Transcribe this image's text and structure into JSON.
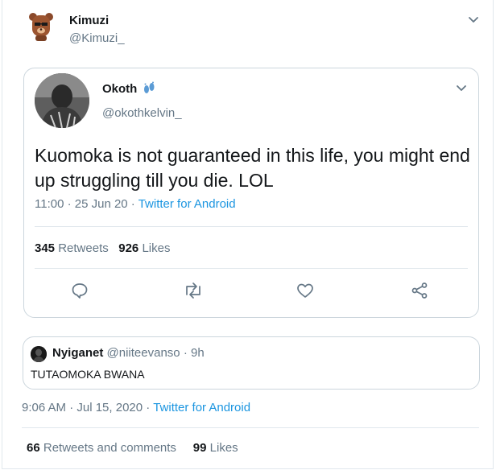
{
  "outer": {
    "name": "Kimuzi",
    "handle": "@Kimuzi_",
    "timestamp": "9:06 AM · Jul 15, 2020",
    "client": "Twitter for Android",
    "retweets_comments_count": "66",
    "retweets_comments_label": "Retweets and comments",
    "likes_count": "99",
    "likes_label": "Likes"
  },
  "quoted": {
    "name": "Okoth",
    "name_emoji": "footprints-icon",
    "handle": "@okothkelvin_",
    "text": "Kuomoka is not guaranteed in this life, you might end up struggling till you die. LOL",
    "time": "11:00 · 25 Jun 20 ·",
    "client": "Twitter for Android",
    "retweets_count": "345",
    "retweets_label": "Retweets",
    "likes_count": "926",
    "likes_label": "Likes"
  },
  "reply": {
    "name": "Nyiganet",
    "handle": "@niiteevanso",
    "age": "· 9h",
    "text": "TUTAOMOKA BWANA"
  },
  "colors": {
    "link": "#1b95e0",
    "muted": "#657786",
    "text": "#14171a",
    "border": "#ccd6dd"
  }
}
